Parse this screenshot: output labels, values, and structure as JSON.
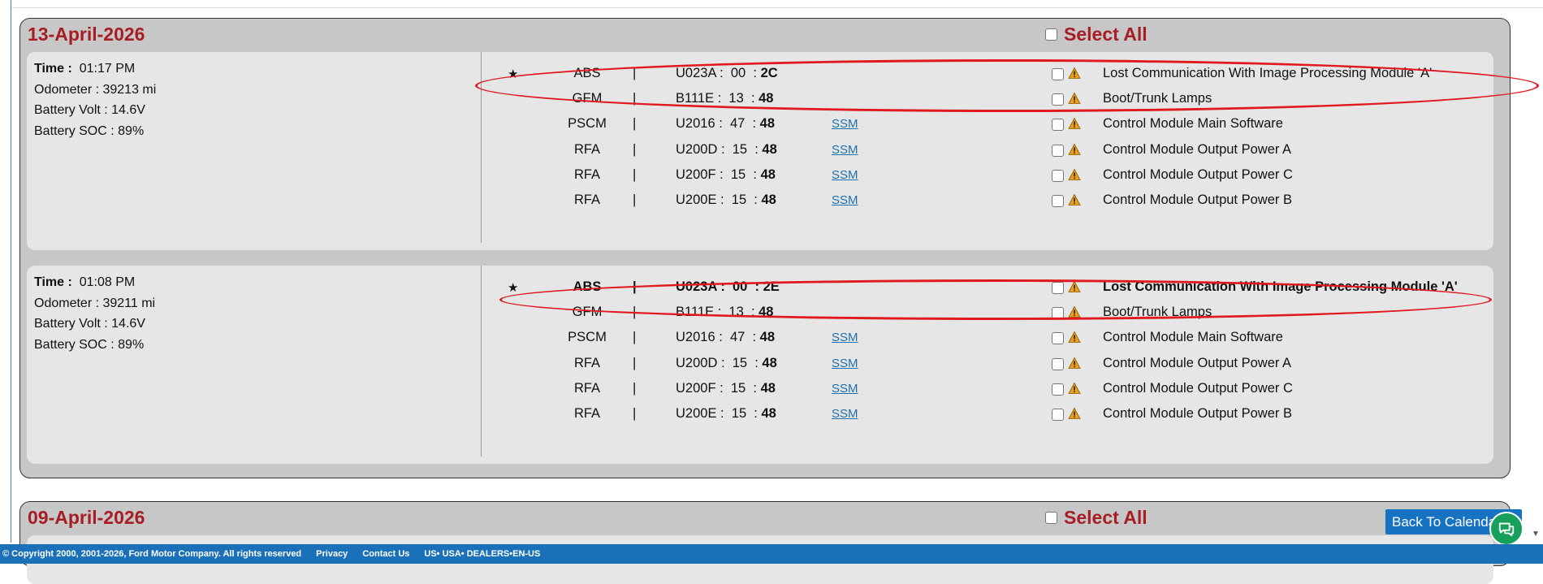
{
  "groups": [
    {
      "date": "13-April-2026",
      "select_all": "Select All",
      "records": [
        {
          "time_label": "Time :",
          "time": "01:17 PM",
          "odometer": "Odometer :  39213 mi",
          "battery_volt": "Battery Volt : 14.6V",
          "battery_soc": "Battery SOC : 89%",
          "dtcs": [
            {
              "star": "★",
              "module": "ABS",
              "sep": "|",
              "code": "U023A :  00  : ",
              "status": "2C",
              "ssm": "",
              "description": "Lost Communication With Image Processing Module 'A'",
              "bold": false
            },
            {
              "star": "",
              "module": "GFM",
              "sep": "|",
              "code": "B111E :  13  : ",
              "status": "48",
              "ssm": "",
              "description": "Boot/Trunk Lamps",
              "bold": false
            },
            {
              "star": "",
              "module": "PSCM",
              "sep": "|",
              "code": "U2016 :  47  : ",
              "status": "48",
              "ssm": "SSM",
              "description": "Control Module Main Software",
              "bold": false
            },
            {
              "star": "",
              "module": "RFA",
              "sep": "|",
              "code": "U200D :  15  : ",
              "status": "48",
              "ssm": "SSM",
              "description": "Control Module Output Power A",
              "bold": false
            },
            {
              "star": "",
              "module": "RFA",
              "sep": "|",
              "code": "U200F :  15  : ",
              "status": "48",
              "ssm": "SSM",
              "description": "Control Module Output Power C",
              "bold": false
            },
            {
              "star": "",
              "module": "RFA",
              "sep": "|",
              "code": "U200E :  15  : ",
              "status": "48",
              "ssm": "SSM",
              "description": "Control Module Output Power B",
              "bold": false
            }
          ]
        },
        {
          "time_label": "Time :",
          "time": "01:08 PM",
          "odometer": "Odometer :  39211 mi",
          "battery_volt": "Battery Volt : 14.6V",
          "battery_soc": "Battery SOC : 89%",
          "dtcs": [
            {
              "star": "★",
              "module": "ABS",
              "sep": "|",
              "code": "U023A :  00  : ",
              "status": "2E",
              "ssm": "",
              "description": "Lost Communication With Image Processing Module 'A'",
              "bold": true
            },
            {
              "star": "",
              "module": "GFM",
              "sep": "|",
              "code": "B111E :  13  : ",
              "status": "48",
              "ssm": "",
              "description": "Boot/Trunk Lamps",
              "bold": false
            },
            {
              "star": "",
              "module": "PSCM",
              "sep": "|",
              "code": "U2016 :  47  : ",
              "status": "48",
              "ssm": "SSM",
              "description": "Control Module Main Software",
              "bold": false
            },
            {
              "star": "",
              "module": "RFA",
              "sep": "|",
              "code": "U200D :  15  : ",
              "status": "48",
              "ssm": "SSM",
              "description": "Control Module Output Power A",
              "bold": false
            },
            {
              "star": "",
              "module": "RFA",
              "sep": "|",
              "code": "U200F :  15  : ",
              "status": "48",
              "ssm": "SSM",
              "description": "Control Module Output Power C",
              "bold": false
            },
            {
              "star": "",
              "module": "RFA",
              "sep": "|",
              "code": "U200E :  15  : ",
              "status": "48",
              "ssm": "SSM",
              "description": "Control Module Output Power B",
              "bold": false
            }
          ]
        }
      ]
    },
    {
      "date": "09-April-2026",
      "select_all": "Select All",
      "records": []
    }
  ],
  "back_button": "Back To Calendar",
  "icons": {
    "warning": "warning-triangle-icon",
    "chat": "chat-bubble-icon",
    "scroll": "scroll-down-arrow-icon"
  },
  "colors": {
    "date_title": "#a61d24",
    "highlight_ellipse": "#e0191e",
    "footer": "#1a71b9",
    "back_button": "#1673c2",
    "chat_button": "#17a05b",
    "warning": "#e8a01a"
  },
  "footer": {
    "copyright": "© Copyright 2000, 2001-2026, Ford Motor Company. All rights reserved",
    "privacy": "Privacy",
    "contact": "Contact Us",
    "locale": "US• USA• DEALERS•EN-US"
  }
}
